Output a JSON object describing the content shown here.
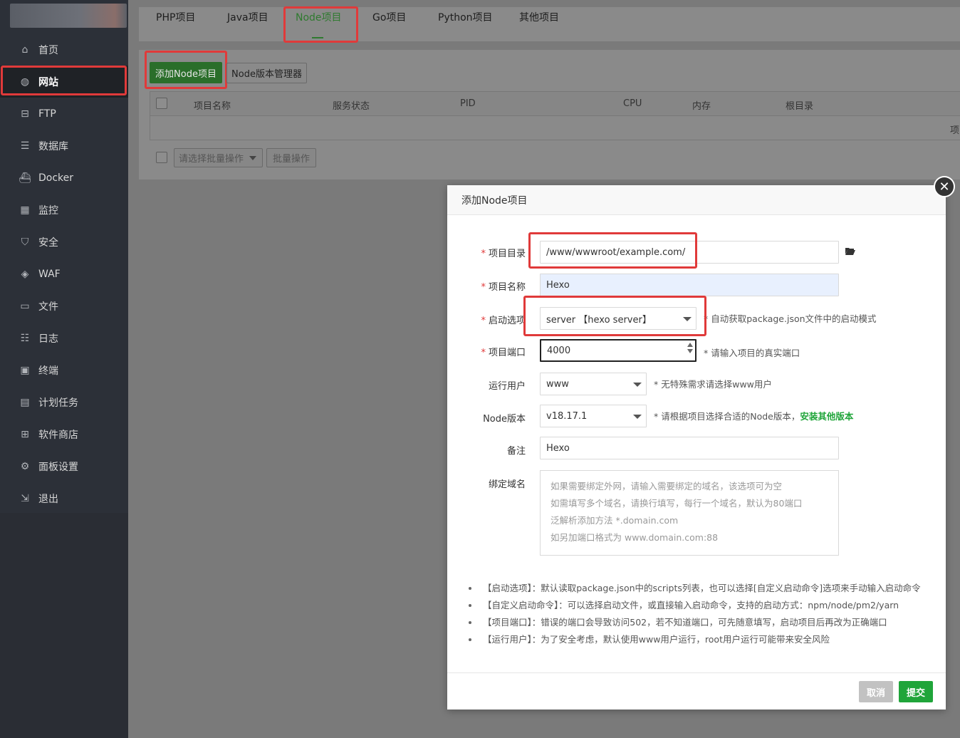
{
  "sidebar": {
    "items": [
      {
        "label": "首页",
        "icon": "home-icon"
      },
      {
        "label": "网站",
        "icon": "globe-icon"
      },
      {
        "label": "FTP",
        "icon": "ftp-icon"
      },
      {
        "label": "数据库",
        "icon": "database-icon"
      },
      {
        "label": "Docker",
        "icon": "docker-icon"
      },
      {
        "label": "监控",
        "icon": "monitor-icon"
      },
      {
        "label": "安全",
        "icon": "shield-icon"
      },
      {
        "label": "WAF",
        "icon": "waf-icon"
      },
      {
        "label": "文件",
        "icon": "folder-icon"
      },
      {
        "label": "日志",
        "icon": "log-icon"
      },
      {
        "label": "终端",
        "icon": "terminal-icon"
      },
      {
        "label": "计划任务",
        "icon": "calendar-icon"
      },
      {
        "label": "软件商店",
        "icon": "apps-icon"
      },
      {
        "label": "面板设置",
        "icon": "gear-icon"
      },
      {
        "label": "退出",
        "icon": "logout-icon"
      }
    ],
    "active": "网站"
  },
  "tabs": [
    "PHP项目",
    "Java项目",
    "Node项目",
    "Go项目",
    "Python项目",
    "其他项目"
  ],
  "active_tab": "Node项目",
  "toolbar": {
    "add_label": "添加Node项目",
    "version_label": "Node版本管理器"
  },
  "table": {
    "headers": [
      "项目名称",
      "服务状态",
      "PID",
      "CPU",
      "内存",
      "根目录"
    ],
    "empty_text": "项"
  },
  "batch": {
    "select_placeholder": "请选择批量操作",
    "button": "批量操作"
  },
  "modal": {
    "title": "添加Node项目",
    "fields": {
      "dir_label": "项目目录",
      "dir_value": "/www/wwwroot/example.com/",
      "name_label": "项目名称",
      "name_value": "Hexo",
      "start_label": "启动选项",
      "start_value": "server 【hexo server】",
      "start_hint": "* 自动获取package.json文件中的启动模式",
      "port_label": "项目端口",
      "port_value": "4000",
      "port_hint": "* 请输入项目的真实端口",
      "user_label": "运行用户",
      "user_value": "www",
      "user_hint": "* 无特殊需求请选择www用户",
      "node_label": "Node版本",
      "node_value": "v18.17.1",
      "node_hint": "* 请根据项目选择合适的Node版本，",
      "node_link": "安装其他版本",
      "remark_label": "备注",
      "remark_value": "Hexo",
      "domain_label": "绑定域名",
      "domain_placeholder": [
        "如果需要绑定外网，请输入需要绑定的域名，该选项可为空",
        "如需填写多个域名，请换行填写，每行一个域名，默认为80端口",
        "泛解析添加方法 *.domain.com",
        "如另加端口格式为 www.domain.com:88"
      ]
    },
    "notes": [
      "【启动选项】：默认读取package.json中的scripts列表，也可以选择[自定义启动命令]选项来手动输入启动命令",
      "【自定义启动命令】：可以选择启动文件，或直接输入启动命令，支持的启动方式：npm/node/pm2/yarn",
      "【项目端口】：错误的端口会导致访问502，若不知道端口，可先随意填写，启动项目后再改为正确端口",
      "【运行用户】：为了安全考虑，默认使用www用户运行，root用户运行可能带来安全风险"
    ],
    "cancel_label": "取消",
    "submit_label": "提交"
  },
  "colors": {
    "accent_green": "#20a53a",
    "highlight_red": "#e03a3a"
  }
}
